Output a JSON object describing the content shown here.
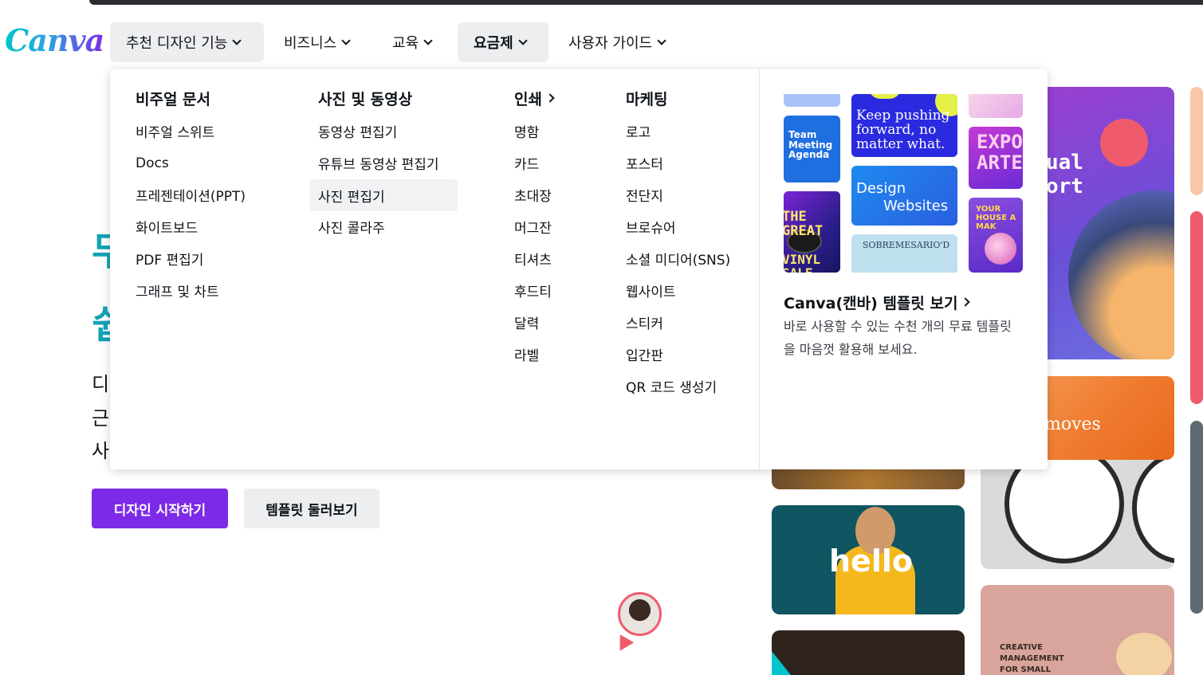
{
  "logo": {
    "text": "Canva"
  },
  "nav": {
    "items": [
      {
        "label": "추천 디자인 기능"
      },
      {
        "label": "비즈니스"
      },
      {
        "label": "교육"
      },
      {
        "label": "요금제"
      },
      {
        "label": "사용자 가이드"
      }
    ]
  },
  "hero": {
    "big_1": "무",
    "big_2": "쉽",
    "line_1": "디",
    "line_2": "근",
    "line_3": "사",
    "primary_button": "디자인 시작하기",
    "secondary_button": "템플릿 둘러보기"
  },
  "dropdown": {
    "columns": [
      {
        "title": "비주얼 문서",
        "items": [
          "비주얼 스위트",
          "Docs",
          "프레젠테이션(PPT)",
          "화이트보드",
          "PDF 편집기",
          "그래프 및 차트"
        ]
      },
      {
        "title": "사진 및 동영상",
        "items": [
          "동영상 편집기",
          "유튜브 동영상 편집기",
          "사진 편집기",
          "사진 콜라주"
        ],
        "highlighted_index": 2
      },
      {
        "title": "인쇄",
        "items": [
          "명함",
          "카드",
          "초대장",
          "머그잔",
          "티셔츠",
          "후드티",
          "달력",
          "라벨"
        ]
      },
      {
        "title": "마케팅",
        "items": [
          "로고",
          "포스터",
          "전단지",
          "브로슈어",
          "소셜 미디어(SNS)",
          "웹사이트",
          "스티커",
          "입간판",
          "QR 코드 생성기"
        ]
      }
    ],
    "thumbnails": {
      "team_meeting": "Team Meeting Agenda",
      "keep_pushing": "Keep pushing forward, no matter what.",
      "design_websites": "Design Websites",
      "expo_arte": "EXPO ARTE",
      "the_great": "THE GREAT",
      "vinyl_sale": "VINYL SALE",
      "sobremesa": "SOBREMESARIO'D",
      "your_house": "YOUR HOUSE A MAK"
    },
    "promo": {
      "title": "Canva(캔바) 템플릿 보기",
      "description": "바로 사용할 수 있는 수천 개의 무료 템플릿을 마음껏 활용해 보세요."
    }
  },
  "background_cards": {
    "visual_report": "ual\nort",
    "moves": "moves",
    "hello": "hello",
    "creative": "CREATIVE MANAGEMENT FOR SMALL"
  },
  "colors": {
    "accent": "#7d2ae8",
    "teal": "#00c4cc",
    "nav_active_bg": "#edeef0"
  }
}
